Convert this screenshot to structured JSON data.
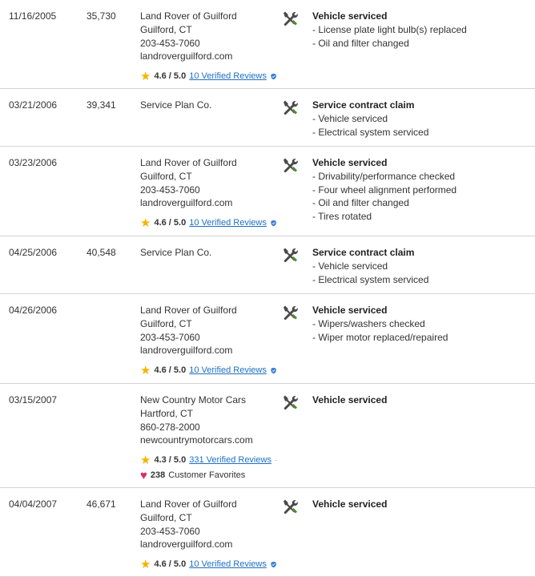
{
  "records": [
    {
      "date": "11/16/2005",
      "mileage": "35,730",
      "source_lines": [
        "Land Rover of Guilford",
        "Guilford, CT",
        "203-453-7060",
        "landroverguilford.com"
      ],
      "rating": "4.6 / 5.0",
      "reviews": "10 Verified Reviews",
      "title": "Vehicle serviced",
      "items": [
        "License plate light bulb(s) replaced",
        "Oil and filter changed"
      ]
    },
    {
      "date": "03/21/2006",
      "mileage": "39,341",
      "source_lines": [
        "Service Plan Co."
      ],
      "title": "Service contract claim",
      "items": [
        "Vehicle serviced",
        "Electrical system serviced"
      ]
    },
    {
      "date": "03/23/2006",
      "mileage": "",
      "source_lines": [
        "Land Rover of Guilford",
        "Guilford, CT",
        "203-453-7060",
        "landroverguilford.com"
      ],
      "rating": "4.6 / 5.0",
      "reviews": "10 Verified Reviews",
      "title": "Vehicle serviced",
      "items": [
        "Drivability/performance checked",
        "Four wheel alignment performed",
        "Oil and filter changed",
        "Tires rotated"
      ]
    },
    {
      "date": "04/25/2006",
      "mileage": "40,548",
      "source_lines": [
        "Service Plan Co."
      ],
      "title": "Service contract claim",
      "items": [
        "Vehicle serviced",
        "Electrical system serviced"
      ]
    },
    {
      "date": "04/26/2006",
      "mileage": "",
      "source_lines": [
        "Land Rover of Guilford",
        "Guilford, CT",
        "203-453-7060",
        "landroverguilford.com"
      ],
      "rating": "4.6 / 5.0",
      "reviews": "10 Verified Reviews",
      "title": "Vehicle serviced",
      "items": [
        "Wipers/washers checked",
        "Wiper motor replaced/repaired"
      ]
    },
    {
      "date": "03/15/2007",
      "mileage": "",
      "source_lines": [
        "New Country Motor Cars",
        "Hartford, CT",
        "860-278-2000",
        "newcountrymotorcars.com"
      ],
      "rating": "4.3 / 5.0",
      "reviews": "331 Verified Reviews",
      "favorites_count": "238",
      "favorites_label": "Customer Favorites",
      "title": "Vehicle serviced",
      "items": []
    },
    {
      "date": "04/04/2007",
      "mileage": "46,671",
      "source_lines": [
        "Land Rover of Guilford",
        "Guilford, CT",
        "203-453-7060",
        "landroverguilford.com"
      ],
      "rating": "4.6 / 5.0",
      "reviews": "10 Verified Reviews",
      "title": "Vehicle serviced",
      "items": []
    }
  ],
  "colors": {
    "link": "#1f6fc1",
    "star": "#f4b400",
    "heart": "#d62c6a",
    "divider": "#d4d4d4",
    "tool_icon": "#4a8c2e"
  },
  "icons": {
    "service": "wrench-screwdriver-icon",
    "rating": "star-icon",
    "verified": "verified-shield-icon",
    "favorites": "heart-icon"
  }
}
